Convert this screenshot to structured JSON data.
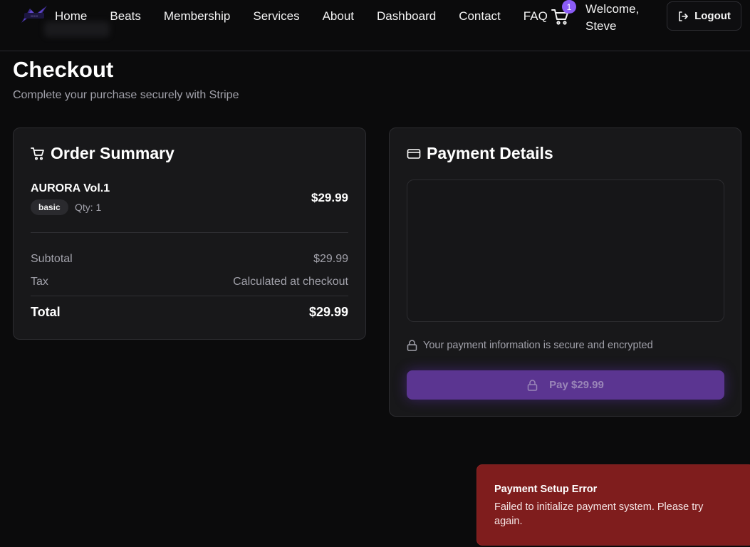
{
  "nav": {
    "links": [
      "Home",
      "Beats",
      "Membership",
      "Services",
      "About",
      "Dashboard",
      "Contact",
      "FAQ"
    ],
    "cart_count": "1",
    "welcome": "Welcome, Steve",
    "logout_label": "Logout"
  },
  "page": {
    "title": "Checkout",
    "subtitle": "Complete your purchase securely with Stripe"
  },
  "order_summary": {
    "title": "Order Summary",
    "item": {
      "name": "AURORA Vol.1",
      "license": "basic",
      "qty": "Qty: 1",
      "price": "$29.99"
    },
    "subtotal_label": "Subtotal",
    "subtotal_value": "$29.99",
    "tax_label": "Tax",
    "tax_value": "Calculated at checkout",
    "total_label": "Total",
    "total_value": "$29.99"
  },
  "payment": {
    "title": "Payment Details",
    "secure_note": "Your payment information is secure and encrypted",
    "pay_label": "Pay $29.99"
  },
  "toast": {
    "title": "Payment Setup Error",
    "message": "Failed to initialize payment system. Please try again."
  },
  "colors": {
    "accent": "#8b5cf6",
    "pay_button": "#5b3591",
    "error": "#7f1d1d",
    "background": "#0b0b0c",
    "card": "#18181a"
  },
  "icons": [
    "logo-icon",
    "cart-icon",
    "logout-icon",
    "shopping-cart-icon",
    "credit-card-icon",
    "lock-icon"
  ]
}
